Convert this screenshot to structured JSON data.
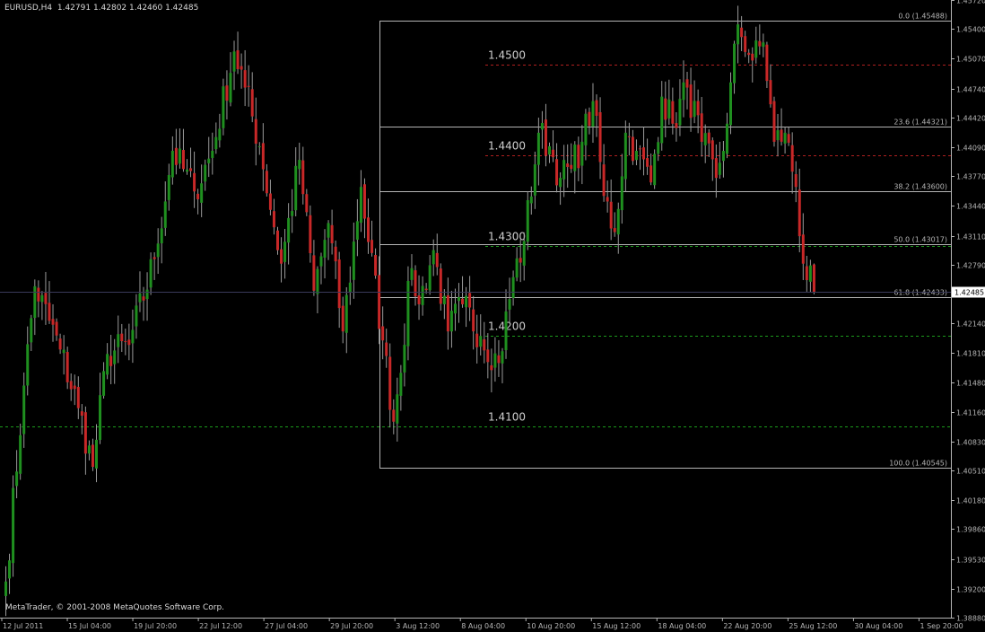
{
  "window": {
    "symbol_label": "EURUSD,H4",
    "ohlc_values": "1.42791 1.42802 1.42460 1.42485",
    "copyright": "MetaTrader, © 2001-2008 MetaQuotes Software Corp."
  },
  "colors": {
    "background": "#000000",
    "bull": "#1f8f1f",
    "bear": "#c82828",
    "wick": "#9a9a9a",
    "axis": "#b4b4b4",
    "fib": "#b4b4b4",
    "level_red": "#b02020",
    "level_green": "#1c9a1c"
  },
  "chart_data": {
    "type": "candlestick",
    "symbol": "EURUSD",
    "timeframe": "H4",
    "last_ohlc": {
      "open": 1.42791,
      "high": 1.42802,
      "low": 1.4246,
      "close": 1.42485
    },
    "current_price_label": "1.42485",
    "y_ticks": [
      "1.45720",
      "1.45400",
      "1.45070",
      "1.44740",
      "1.44420",
      "1.44090",
      "1.43770",
      "1.43440",
      "1.43110",
      "1.42790",
      "1.42460",
      "1.42140",
      "1.41810",
      "1.41480",
      "1.41160",
      "1.40830",
      "1.40510",
      "1.40180",
      "1.39860",
      "1.39530",
      "1.39200",
      "1.38880"
    ],
    "ylim": [
      1.3888,
      1.4572
    ],
    "x_ticks": [
      "12 Jul 2011",
      "15 Jul 04:00",
      "19 Jul 20:00",
      "22 Jul 12:00",
      "27 Jul 04:00",
      "29 Jul 20:00",
      "3 Aug 12:00",
      "8 Aug 04:00",
      "10 Aug 20:00",
      "15 Aug 12:00",
      "18 Aug 04:00",
      "22 Aug 20:00",
      "25 Aug 12:00",
      "30 Aug 04:00",
      "1 Sep 20:00"
    ],
    "horizontal_levels": [
      {
        "label": "1.4500",
        "value": 1.45,
        "color": "red",
        "style": "dashed"
      },
      {
        "label": "1.4400",
        "value": 1.44,
        "color": "red",
        "style": "dashed"
      },
      {
        "label": "1.4300",
        "value": 1.43,
        "color": "green",
        "style": "dashed"
      },
      {
        "label": "1.4200",
        "value": 1.42,
        "color": "green",
        "style": "dashed"
      },
      {
        "label": "1.4100",
        "value": 1.41,
        "color": "green",
        "style": "dashed"
      }
    ],
    "fibonacci": [
      {
        "label": "0.0 (1.45488)",
        "value": 1.45488
      },
      {
        "label": "23.6 (1.44321)",
        "value": 1.44321
      },
      {
        "label": "38.2 (1.43600)",
        "value": 1.436
      },
      {
        "label": "50.0 (1.43017)",
        "value": 1.43017
      },
      {
        "label": "61.8 (1.42433)",
        "value": 1.42433
      },
      {
        "label": "100.0 (1.40545)",
        "value": 1.40545
      }
    ],
    "swing_anchors": [
      {
        "index": 0,
        "value": 1.3928
      },
      {
        "index": 5,
        "value": 1.4145
      },
      {
        "index": 8,
        "value": 1.4255
      },
      {
        "index": 15,
        "value": 1.4185
      },
      {
        "index": 20,
        "value": 1.412
      },
      {
        "index": 24,
        "value": 1.4055
      },
      {
        "index": 28,
        "value": 1.418
      },
      {
        "index": 34,
        "value": 1.419
      },
      {
        "index": 41,
        "value": 1.4285
      },
      {
        "index": 46,
        "value": 1.4405
      },
      {
        "index": 52,
        "value": 1.436
      },
      {
        "index": 57,
        "value": 1.4405
      },
      {
        "index": 63,
        "value": 1.4515
      },
      {
        "index": 66,
        "value": 1.4475
      },
      {
        "index": 70,
        "value": 1.441
      },
      {
        "index": 76,
        "value": 1.428
      },
      {
        "index": 81,
        "value": 1.4395
      },
      {
        "index": 85,
        "value": 1.425
      },
      {
        "index": 89,
        "value": 1.4325
      },
      {
        "index": 93,
        "value": 1.4205
      },
      {
        "index": 98,
        "value": 1.4365
      },
      {
        "index": 104,
        "value": 1.4195
      },
      {
        "index": 107,
        "value": 1.4105
      },
      {
        "index": 112,
        "value": 1.4275
      },
      {
        "index": 114,
        "value": 1.4235
      },
      {
        "index": 118,
        "value": 1.4295
      },
      {
        "index": 122,
        "value": 1.4205
      },
      {
        "index": 126,
        "value": 1.4235
      },
      {
        "index": 131,
        "value": 1.42
      },
      {
        "index": 136,
        "value": 1.417
      },
      {
        "index": 140,
        "value": 1.4265
      },
      {
        "index": 143,
        "value": 1.4305
      },
      {
        "index": 147,
        "value": 1.4425
      },
      {
        "index": 150,
        "value": 1.441
      },
      {
        "index": 153,
        "value": 1.4375
      },
      {
        "index": 156,
        "value": 1.4385
      },
      {
        "index": 159,
        "value": 1.4415
      },
      {
        "index": 162,
        "value": 1.446
      },
      {
        "index": 165,
        "value": 1.4355
      },
      {
        "index": 168,
        "value": 1.4315
      },
      {
        "index": 171,
        "value": 1.4425
      },
      {
        "index": 174,
        "value": 1.4405
      },
      {
        "index": 178,
        "value": 1.437
      },
      {
        "index": 181,
        "value": 1.4465
      },
      {
        "index": 184,
        "value": 1.4435
      },
      {
        "index": 188,
        "value": 1.4475
      },
      {
        "index": 192,
        "value": 1.4415
      },
      {
        "index": 196,
        "value": 1.4375
      },
      {
        "index": 199,
        "value": 1.4435
      },
      {
        "index": 202,
        "value": 1.4545
      },
      {
        "index": 206,
        "value": 1.4505
      },
      {
        "index": 209,
        "value": 1.4525
      },
      {
        "index": 212,
        "value": 1.4415
      },
      {
        "index": 215,
        "value": 1.4425
      },
      {
        "index": 218,
        "value": 1.4365
      },
      {
        "index": 220,
        "value": 1.428
      },
      {
        "index": 223,
        "value": 1.4248
      }
    ]
  }
}
